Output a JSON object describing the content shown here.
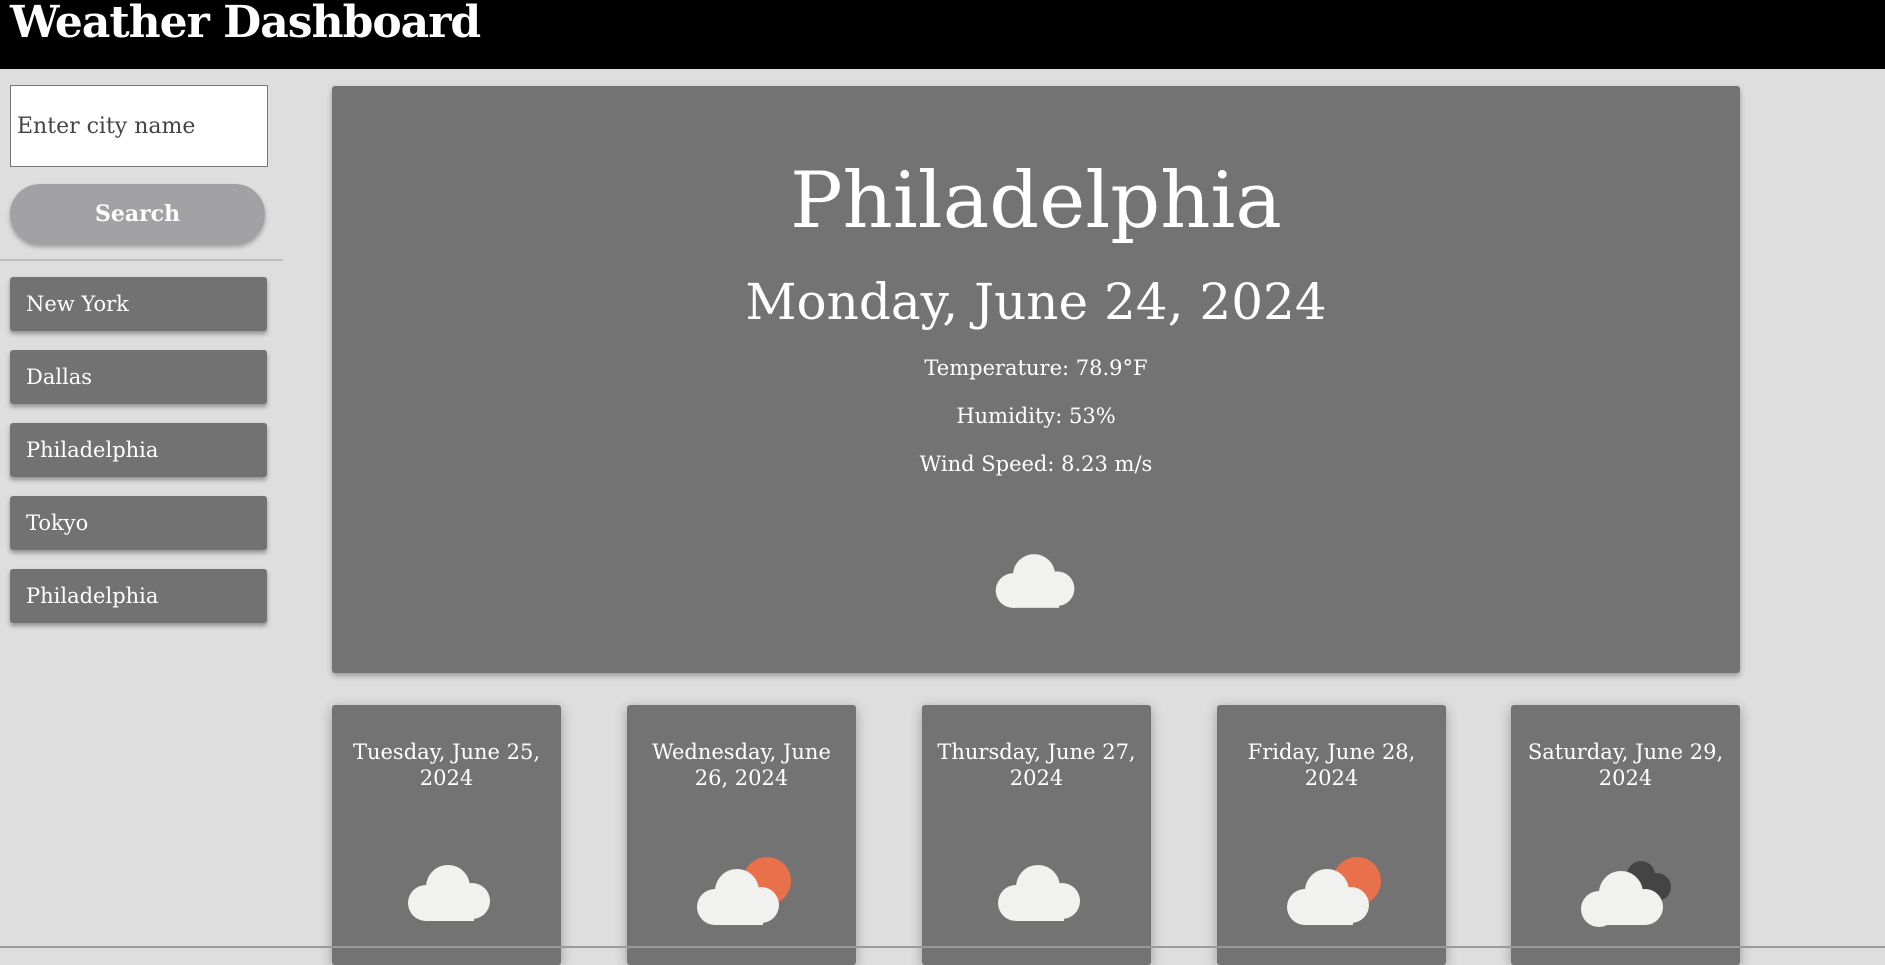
{
  "header": {
    "title": "Weather Dashboard"
  },
  "search": {
    "placeholder": "Enter city name",
    "button_label": "Search"
  },
  "history": [
    {
      "label": "New York"
    },
    {
      "label": "Dallas"
    },
    {
      "label": "Philadelphia"
    },
    {
      "label": "Tokyo"
    },
    {
      "label": "Philadelphia"
    }
  ],
  "current": {
    "city": "Philadelphia",
    "date": "Monday, June 24, 2024",
    "temperature": "Temperature: 78.9°F",
    "humidity": "Humidity: 53%",
    "wind": "Wind Speed: 8.23 m/s",
    "icon": "cloud-icon"
  },
  "forecast": [
    {
      "date": "Tuesday, June 25, 2024",
      "icon": "cloud-icon"
    },
    {
      "date": "Wednesday, June 26, 2024",
      "icon": "partly-sunny-icon"
    },
    {
      "date": "Thursday, June 27, 2024",
      "icon": "cloud-icon"
    },
    {
      "date": "Friday, June 28, 2024",
      "icon": "partly-sunny-icon"
    },
    {
      "date": "Saturday, June 29, 2024",
      "icon": "overcast-clouds-icon"
    }
  ],
  "colors": {
    "header_bg": "#000000",
    "page_bg": "#dedede",
    "card_bg": "#737373",
    "button_bg": "#a2a2a4",
    "sun": "#e8704a",
    "cloud_light": "#f1f1ef",
    "cloud_dark": "#444444"
  }
}
